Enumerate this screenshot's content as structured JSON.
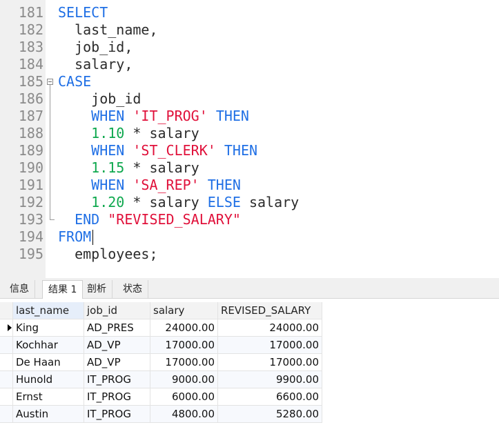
{
  "editor": {
    "lines": [
      {
        "n": "181",
        "tokens": [
          {
            "t": "SELECT",
            "c": "kw"
          }
        ]
      },
      {
        "n": "182",
        "tokens": [
          {
            "t": "  last_name,",
            "c": ""
          }
        ]
      },
      {
        "n": "183",
        "tokens": [
          {
            "t": "  job_id,",
            "c": ""
          }
        ]
      },
      {
        "n": "184",
        "tokens": [
          {
            "t": "  salary,",
            "c": ""
          }
        ]
      },
      {
        "n": "185",
        "tokens": [
          {
            "t": "CASE",
            "c": "kw"
          }
        ]
      },
      {
        "n": "186",
        "tokens": [
          {
            "t": "    job_id",
            "c": ""
          }
        ]
      },
      {
        "n": "187",
        "tokens": [
          {
            "t": "    ",
            "c": ""
          },
          {
            "t": "WHEN",
            "c": "kw"
          },
          {
            "t": " ",
            "c": ""
          },
          {
            "t": "'IT_PROG'",
            "c": "str"
          },
          {
            "t": " ",
            "c": ""
          },
          {
            "t": "THEN",
            "c": "kw"
          }
        ]
      },
      {
        "n": "188",
        "tokens": [
          {
            "t": "    ",
            "c": ""
          },
          {
            "t": "1.10",
            "c": "num"
          },
          {
            "t": " * salary",
            "c": ""
          }
        ]
      },
      {
        "n": "189",
        "tokens": [
          {
            "t": "    ",
            "c": ""
          },
          {
            "t": "WHEN",
            "c": "kw"
          },
          {
            "t": " ",
            "c": ""
          },
          {
            "t": "'ST_CLERK'",
            "c": "str"
          },
          {
            "t": " ",
            "c": ""
          },
          {
            "t": "THEN",
            "c": "kw"
          }
        ]
      },
      {
        "n": "190",
        "tokens": [
          {
            "t": "    ",
            "c": ""
          },
          {
            "t": "1.15",
            "c": "num"
          },
          {
            "t": " * salary",
            "c": ""
          }
        ]
      },
      {
        "n": "191",
        "tokens": [
          {
            "t": "    ",
            "c": ""
          },
          {
            "t": "WHEN",
            "c": "kw"
          },
          {
            "t": " ",
            "c": ""
          },
          {
            "t": "'SA_REP'",
            "c": "str"
          },
          {
            "t": " ",
            "c": ""
          },
          {
            "t": "THEN",
            "c": "kw"
          }
        ]
      },
      {
        "n": "192",
        "tokens": [
          {
            "t": "    ",
            "c": ""
          },
          {
            "t": "1.20",
            "c": "num"
          },
          {
            "t": " * salary ",
            "c": ""
          },
          {
            "t": "ELSE",
            "c": "kw"
          },
          {
            "t": " salary",
            "c": ""
          }
        ]
      },
      {
        "n": "193",
        "tokens": [
          {
            "t": "  ",
            "c": ""
          },
          {
            "t": "END",
            "c": "kw"
          },
          {
            "t": " ",
            "c": ""
          },
          {
            "t": "\"REVISED_SALARY\"",
            "c": "str"
          }
        ]
      },
      {
        "n": "194",
        "tokens": [
          {
            "t": "FROM",
            "c": "kw"
          }
        ]
      },
      {
        "n": "195",
        "tokens": [
          {
            "t": "  employees;",
            "c": ""
          }
        ]
      }
    ]
  },
  "tabs": [
    {
      "label": "信息",
      "active": false
    },
    {
      "label": "结果 1",
      "active": true
    },
    {
      "label": "剖析",
      "active": false
    },
    {
      "label": "状态",
      "active": false
    }
  ],
  "results": {
    "columns": [
      "last_name",
      "job_id",
      "salary",
      "REVISED_SALARY"
    ],
    "rows": [
      [
        "King",
        "AD_PRES",
        "24000.00",
        "24000.00"
      ],
      [
        "Kochhar",
        "AD_VP",
        "17000.00",
        "17000.00"
      ],
      [
        "De Haan",
        "AD_VP",
        "17000.00",
        "17000.00"
      ],
      [
        "Hunold",
        "IT_PROG",
        "9000.00",
        "9900.00"
      ],
      [
        "Ernst",
        "IT_PROG",
        "6000.00",
        "6600.00"
      ],
      [
        "Austin",
        "IT_PROG",
        "4800.00",
        "5280.00"
      ]
    ]
  }
}
